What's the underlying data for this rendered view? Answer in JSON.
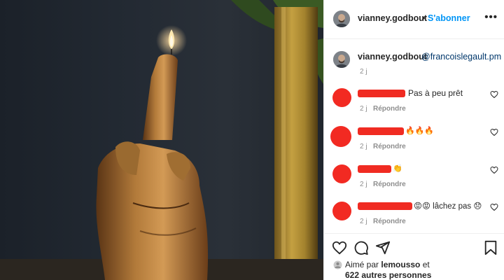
{
  "post": {
    "author": "vianney.godbout",
    "follow_label": "S'abonner",
    "more_label": "•••",
    "separator": "•"
  },
  "caption": {
    "author": "vianney.godbout",
    "mention": "@francoislegault.pm",
    "time": "2 j"
  },
  "comments": [
    {
      "text": "Pas à peu prêt",
      "time": "2 j",
      "reply_label": "Répondre"
    },
    {
      "text": "🔥🔥🔥",
      "time": "2 j",
      "reply_label": "Répondre"
    },
    {
      "text": "👏",
      "time": "2 j",
      "reply_label": "Répondre"
    },
    {
      "text": "😡😡 lâchez pas 😞",
      "time": "2 j",
      "reply_label": "Répondre"
    }
  ],
  "likes": {
    "prefix": "Aimé par",
    "user": "lemousso",
    "conj": "et",
    "others": "622 autres personnes"
  },
  "colors": {
    "accent": "#0095f6",
    "mention": "#00376b",
    "redaction": "#f22a22",
    "muted": "#8e8e8e"
  },
  "icons": [
    "heart-icon",
    "comment-icon",
    "share-icon",
    "bookmark-icon",
    "more-icon"
  ]
}
